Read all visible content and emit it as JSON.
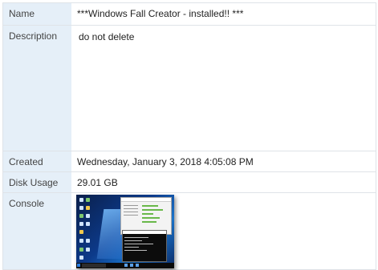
{
  "properties": [
    {
      "label": "Name",
      "value": "***Windows Fall Creator - installed!! ***"
    },
    {
      "label": "Description",
      "value": "do not delete"
    },
    {
      "label": "Created",
      "value": "Wednesday, January 3, 2018 4:05:08 PM"
    },
    {
      "label": "Disk Usage",
      "value": "29.01 GB"
    },
    {
      "label": "Console"
    }
  ],
  "colors": {
    "label_background": "#e5eff8",
    "border": "#dfe3e8"
  }
}
